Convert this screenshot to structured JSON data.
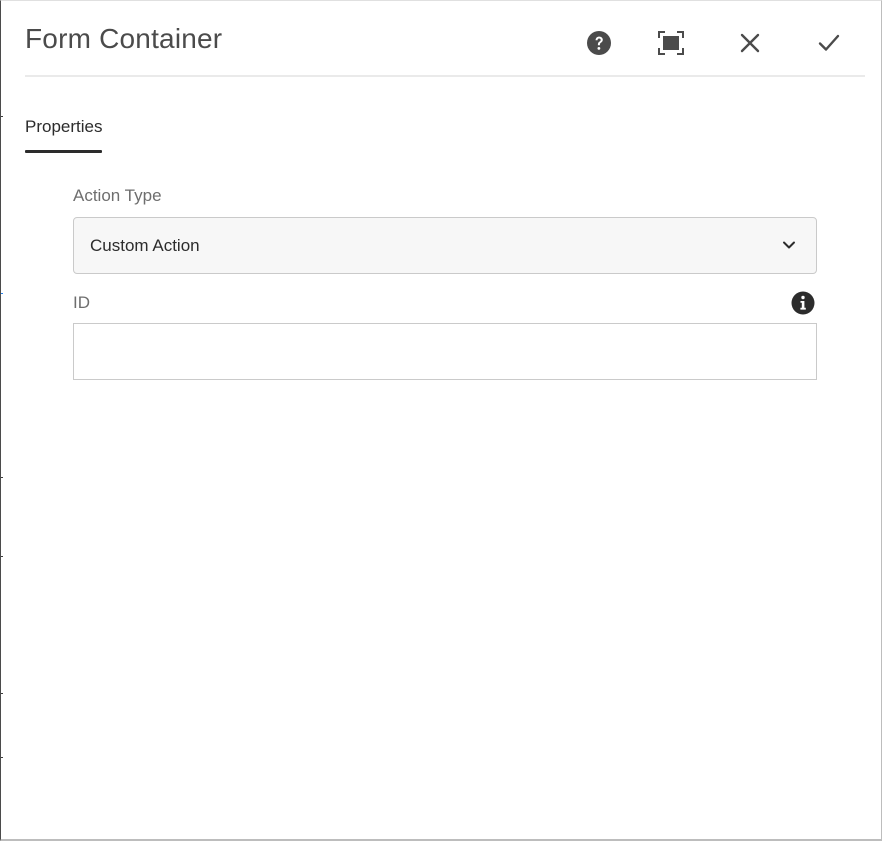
{
  "dialog": {
    "title": "Form Container",
    "header_buttons": [
      {
        "name": "help-button",
        "icon": "help-circle-icon"
      },
      {
        "name": "fullscreen-button",
        "icon": "fullscreen-icon"
      },
      {
        "name": "close-button",
        "icon": "close-icon"
      },
      {
        "name": "done-button",
        "icon": "checkmark-icon"
      }
    ],
    "icon_color": "#4b4b4b"
  },
  "tabs": [
    {
      "label": "Properties",
      "selected": true
    }
  ],
  "form": {
    "action_type": {
      "label": "Action Type",
      "value": "Custom Action",
      "icon": "chevron-down-icon"
    },
    "id_field": {
      "label": "ID",
      "value": "",
      "placeholder": "",
      "info_icon": "info-icon"
    }
  }
}
